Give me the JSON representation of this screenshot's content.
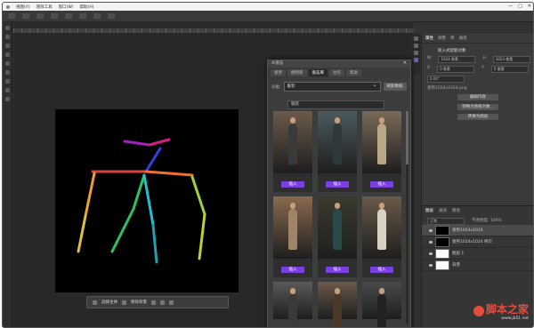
{
  "app": {
    "menu": [
      "视图(V)",
      "增效工具",
      "窗口(W)",
      "帮助(H)"
    ],
    "window_controls": [
      "—",
      "□",
      "✕"
    ]
  },
  "canvas": {
    "background": "#000000",
    "pose_colors": [
      "#e0e040",
      "#a020c0",
      "#e04040",
      "#30c060",
      "#20c0d0",
      "#40a0ff",
      "#f0a030",
      "#d02080"
    ]
  },
  "taskbar": {
    "items": [
      "选择主体",
      "移除背景"
    ]
  },
  "plugin": {
    "title": "AI姿态",
    "tabs": [
      "姿势",
      "模特库",
      "姿态库",
      "动作",
      "帮助"
    ],
    "active_tab": 2,
    "filter_label": "分类:",
    "filter_value": "服装",
    "filter_button": "刷新数据",
    "dropdown_option": "服装",
    "insert_label": "插入",
    "cards": [
      {
        "tone": "#6b5a4a",
        "outfit": "#3a3a3a"
      },
      {
        "tone": "#4b5a5e",
        "outfit": "#2e3a3a"
      },
      {
        "tone": "#7a6a58",
        "outfit": "#b8a888"
      },
      {
        "tone": "#8a6a50",
        "outfit": "#a08468"
      },
      {
        "tone": "#3a3a2e",
        "outfit": "#2a4a4a"
      },
      {
        "tone": "#6a5a4a",
        "outfit": "#d8d0c0"
      },
      {
        "tone": "#5a5a5a",
        "outfit": "#3a3a3a"
      },
      {
        "tone": "#6a5a4a",
        "outfit": "#4a3a2a"
      },
      {
        "tone": "#4a4a4a",
        "outfit": "#222222"
      }
    ]
  },
  "right_panel": {
    "tabs": [
      "属性",
      "调整",
      "库",
      "通道"
    ],
    "title": "嵌入式智能对象",
    "w_label": "W",
    "h_label": "H",
    "w_value": "1024 像素",
    "h_value": "1024 像素",
    "x_value": "0 像素",
    "y_value": "0 像素",
    "angle": "0.00°",
    "link_label": "姿势1024x1024.png",
    "buttons": [
      "编辑内容",
      "转换为链接对象...",
      "转换为图层"
    ]
  },
  "layers": {
    "tabs": [
      "图层",
      "通道",
      "路径"
    ],
    "mode": "正常",
    "opacity": "不透明度: 100%",
    "items": [
      {
        "name": "姿势1024x1024",
        "thumb": "black",
        "selected": true
      },
      {
        "name": "姿势1024x1024 拷贝",
        "thumb": "black",
        "selected": false
      },
      {
        "name": "图层 1",
        "thumb": "white",
        "selected": false
      },
      {
        "name": "背景",
        "thumb": "white",
        "selected": false
      }
    ]
  },
  "watermark": {
    "site": "脚本之家",
    "url": "www.jb51.net"
  }
}
